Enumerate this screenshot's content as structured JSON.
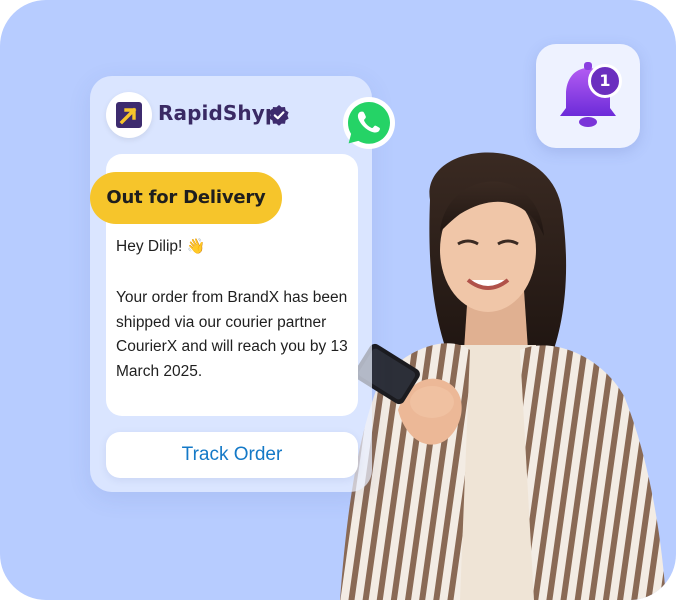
{
  "brand": {
    "name": "RapidShyp",
    "logo_icon": "arrow-up-right-logo-icon",
    "verified_icon": "verified-badge-icon",
    "accent_color": "#3a2a64",
    "logo_color": "#3d2b6e",
    "logo_arrow_color": "#f6c52b"
  },
  "channel": {
    "icon": "whatsapp-icon",
    "color": "#25d366"
  },
  "message": {
    "status": "Out for Delivery",
    "status_color": "#f6c52b",
    "greeting": "Hey Dilip!",
    "greeting_emoji": "👋",
    "body": "Your order from BrandX has been shipped via our courier partner CourierX and will reach you by 13 March 2025.",
    "action_label": "Track Order",
    "action_color": "#1479c7"
  },
  "notification": {
    "icon": "bell-icon",
    "count": "1",
    "bell_color": "#8a3fe0"
  },
  "background_color": "#b7ccff"
}
